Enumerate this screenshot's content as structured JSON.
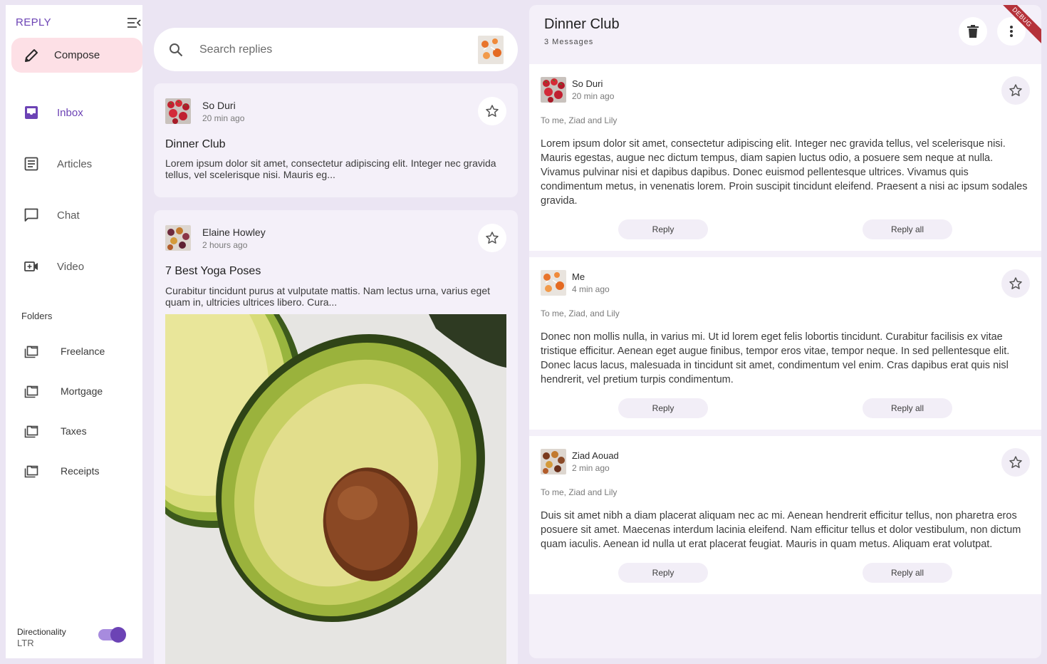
{
  "app": {
    "title": "REPLY"
  },
  "nav": {
    "compose_label": "Compose",
    "items": [
      {
        "label": "Inbox",
        "icon": "inbox-icon",
        "active": true
      },
      {
        "label": "Articles",
        "icon": "article-icon"
      },
      {
        "label": "Chat",
        "icon": "chat-icon"
      },
      {
        "label": "Video",
        "icon": "video-icon"
      }
    ],
    "folders_heading": "Folders",
    "folders": [
      {
        "label": "Freelance"
      },
      {
        "label": "Mortgage"
      },
      {
        "label": "Taxes"
      },
      {
        "label": "Receipts"
      }
    ],
    "directionality": {
      "label": "Directionality",
      "value": "LTR",
      "enabled": true
    }
  },
  "search": {
    "placeholder": "Search replies"
  },
  "list": {
    "cards": [
      {
        "sender": "So Duri",
        "time": "20 min ago",
        "subject": "Dinner Club",
        "preview": "Lorem ipsum dolor sit amet, consectetur adipiscing elit. Integer nec gravida tellus, vel scelerisque nisi. Mauris eg..."
      },
      {
        "sender": "Elaine Howley",
        "time": "2 hours ago",
        "subject": "7 Best Yoga Poses",
        "preview": "Curabitur tincidunt purus at vulputate mattis. Nam lectus urna, varius eget quam in, ultricies ultrices libero. Cura..."
      }
    ]
  },
  "detail": {
    "title": "Dinner Club",
    "count": "3 Messages",
    "messages": [
      {
        "sender": "So Duri",
        "time": "20 min ago",
        "recipients": "To me, Ziad and Lily",
        "body": "Lorem ipsum dolor sit amet, consectetur adipiscing elit. Integer nec gravida tellus, vel scelerisque nisi. Mauris egestas, augue nec dictum tempus, diam sapien luctus odio, a posuere sem neque at nulla. Vivamus pulvinar nisi et dapibus dapibus. Donec euismod pellentesque ultrices. Vivamus quis condimentum metus, in venenatis lorem. Proin suscipit tincidunt eleifend. Praesent a nisi ac ipsum sodales gravida.",
        "reply": "Reply",
        "reply_all": "Reply all"
      },
      {
        "sender": "Me",
        "time": "4 min ago",
        "recipients": "To me, Ziad, and Lily",
        "body": "Donec non mollis nulla, in varius mi. Ut id lorem eget felis lobortis tincidunt. Curabitur facilisis ex vitae tristique efficitur. Aenean eget augue finibus, tempor eros vitae, tempor neque. In sed pellentesque elit. Donec lacus lacus, malesuada in tincidunt sit amet, condimentum vel enim. Cras dapibus erat quis nisl hendrerit, vel pretium turpis condimentum.",
        "reply": "Reply",
        "reply_all": "Reply all"
      },
      {
        "sender": "Ziad Aouad",
        "time": "2 min ago",
        "recipients": "To me, Ziad and Lily",
        "body": "Duis sit amet nibh a diam placerat aliquam nec ac mi. Aenean hendrerit efficitur tellus, non pharetra eros posuere sit amet. Maecenas interdum lacinia eleifend. Nam efficitur tellus et dolor vestibulum, non dictum quam iaculis. Aenean id nulla ut erat placerat feugiat. Mauris in quam metus. Aliquam erat volutpat.",
        "reply": "Reply",
        "reply_all": "Reply all"
      }
    ]
  },
  "debug_banner": "DEBUG",
  "colors": {
    "accent": "#6c43b5",
    "compose_bg": "#fde0e6",
    "surface": "#f4f0f9",
    "background": "#ebe5f3"
  }
}
